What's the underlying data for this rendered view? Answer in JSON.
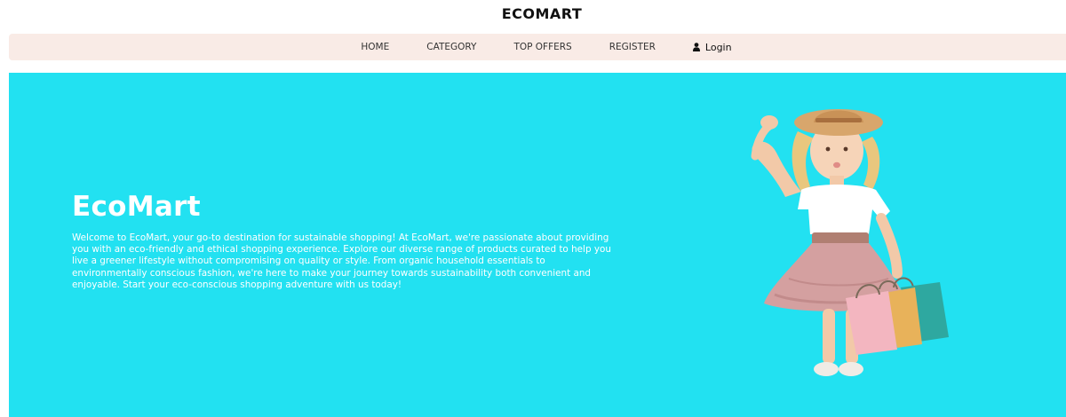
{
  "header": {
    "brand": "ECOMART"
  },
  "nav": {
    "items": [
      {
        "label": "HOME"
      },
      {
        "label": "CATEGORY"
      },
      {
        "label": "TOP OFFERS"
      },
      {
        "label": "REGISTER"
      }
    ],
    "login_label": "Login",
    "login_icon": "user-icon"
  },
  "hero": {
    "title": "EcoMart",
    "description": "Welcome to EcoMart, your go-to destination for sustainable shopping! At EcoMart, we're passionate about providing you with an eco-friendly and ethical shopping experience. Explore our diverse range of products curated to help you live a greener lifestyle without compromising on quality or style. From organic household essentials to environmentally conscious fashion, we're here to make your journey towards sustainability both convenient and enjoyable. Start your eco-conscious shopping adventure with us today!",
    "image": "girl-with-shopping-bags"
  },
  "colors": {
    "hero_background": "#22e1f1",
    "nav_background": "#f9ebe6",
    "text_light": "#ffffff"
  }
}
